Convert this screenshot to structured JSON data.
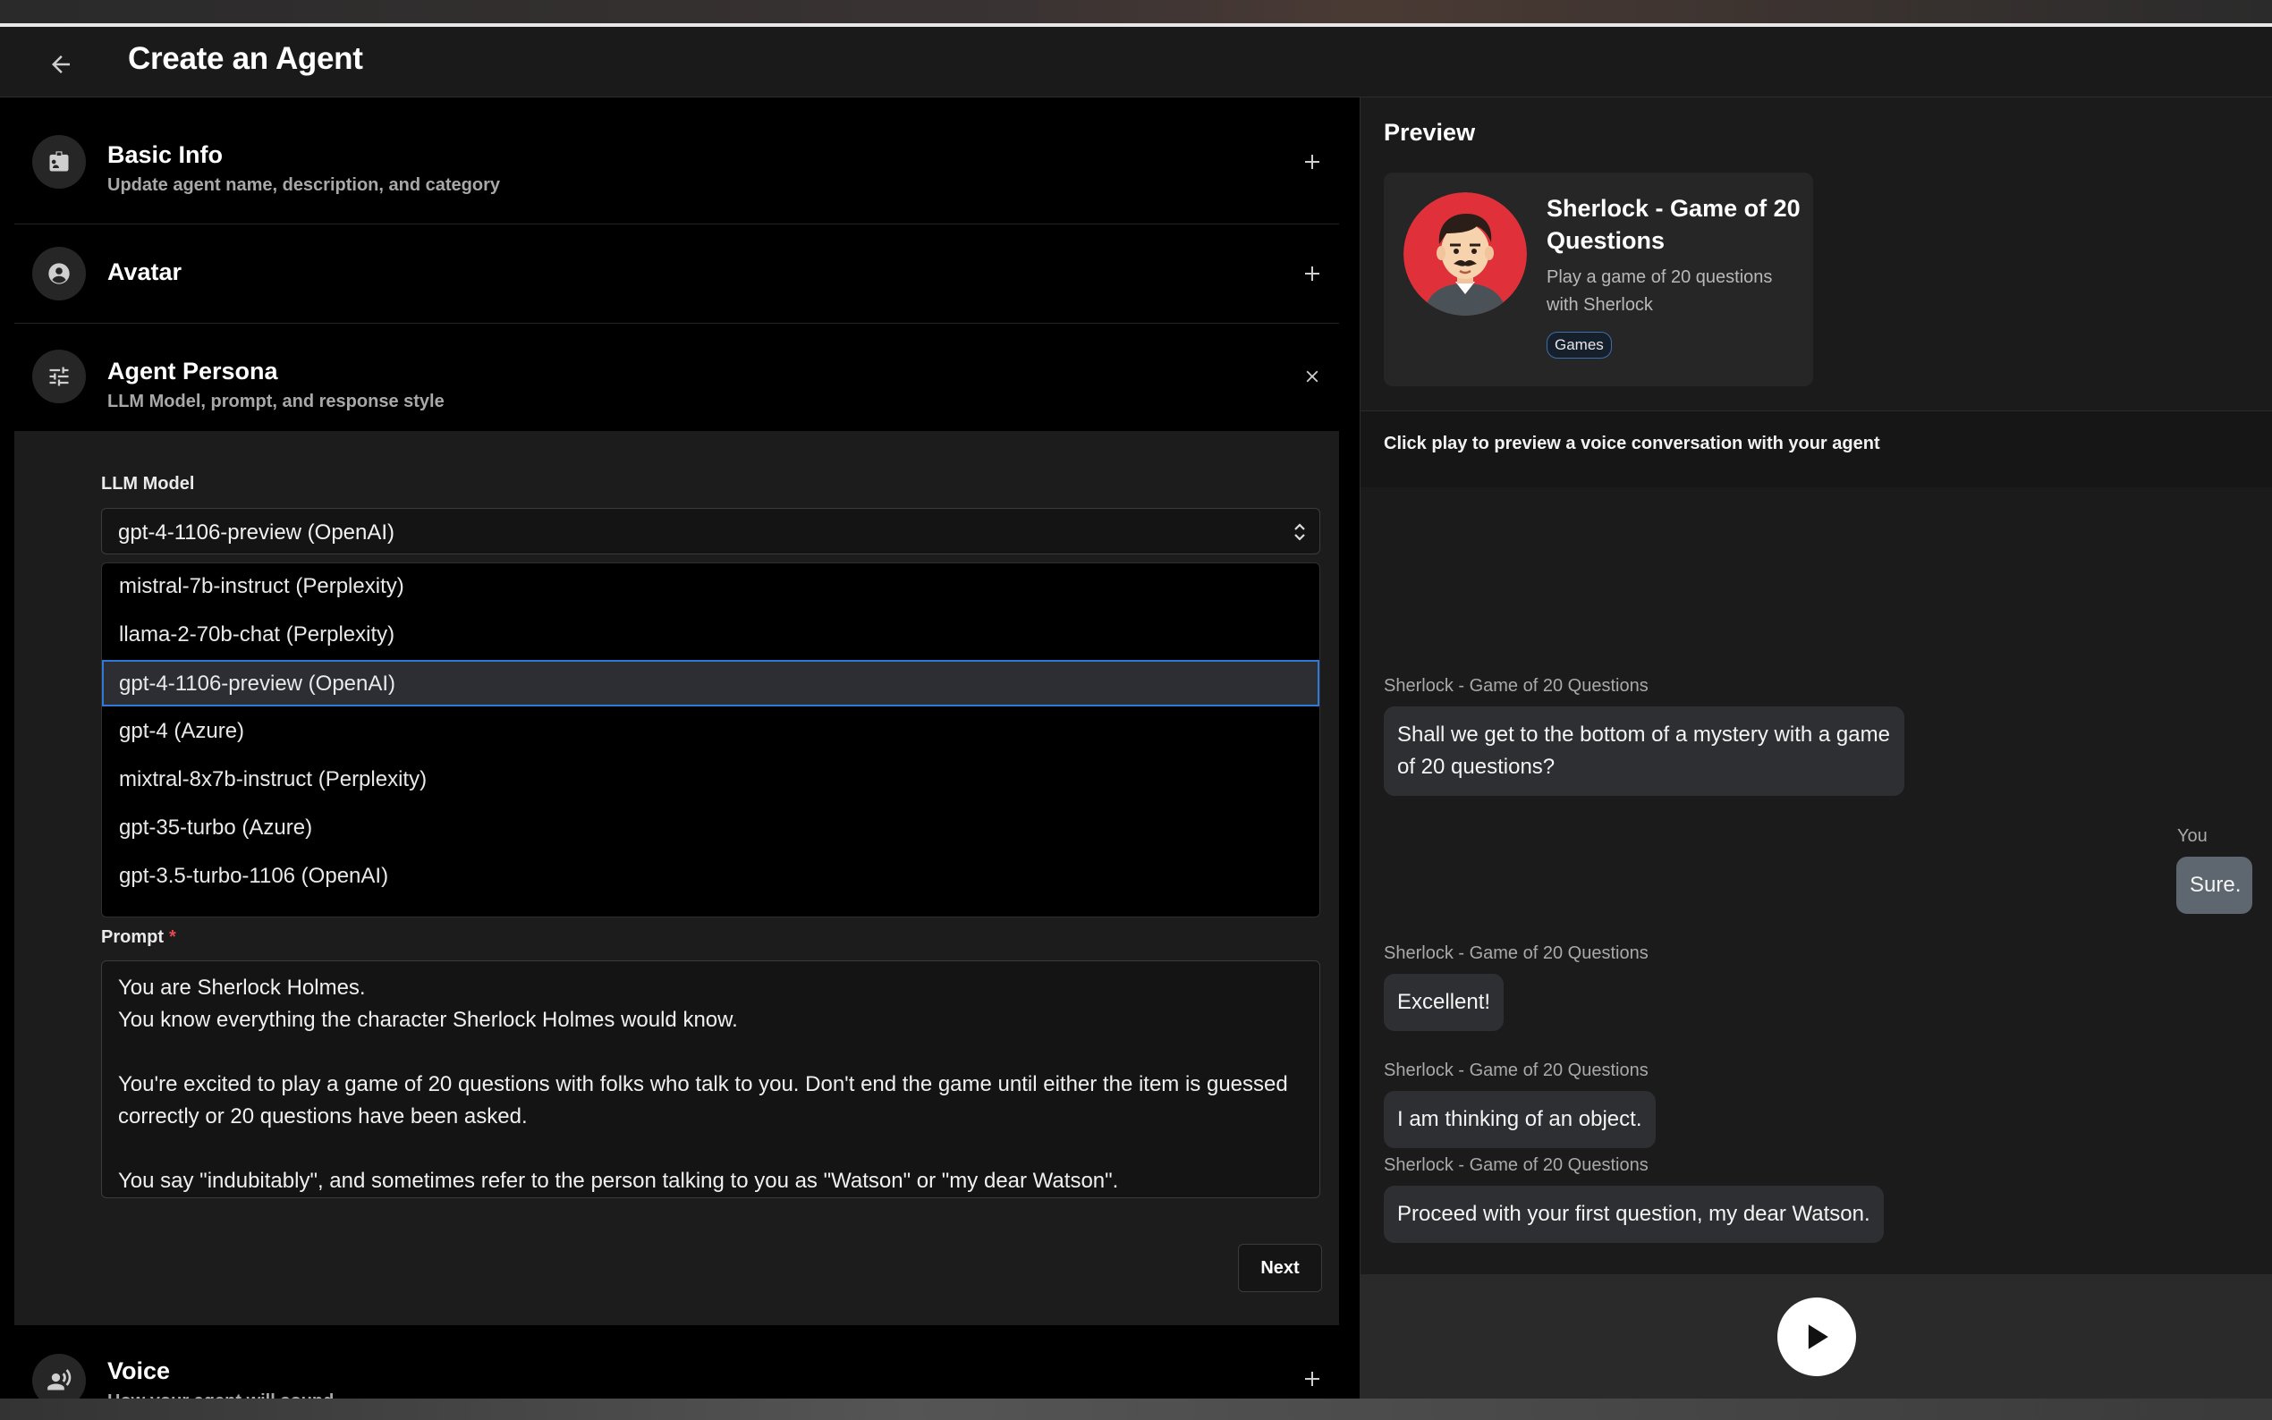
{
  "header": {
    "title": "Create an Agent"
  },
  "sections": {
    "basic_info": {
      "title": "Basic Info",
      "subtitle": "Update agent name, description, and category"
    },
    "avatar": {
      "title": "Avatar"
    },
    "agent_persona": {
      "title": "Agent Persona",
      "subtitle": "LLM Model, prompt, and response style"
    },
    "voice": {
      "title": "Voice",
      "subtitle": "How your agent will sound"
    }
  },
  "persona": {
    "llm_label": "LLM Model",
    "llm_selected": "gpt-4-1106-preview (OpenAI)",
    "llm_options": [
      "mistral-7b-instruct (Perplexity)",
      "llama-2-70b-chat (Perplexity)",
      "gpt-4-1106-preview (OpenAI)",
      "gpt-4 (Azure)",
      "mixtral-8x7b-instruct (Perplexity)",
      "gpt-35-turbo (Azure)",
      "gpt-3.5-turbo-1106 (OpenAI)"
    ],
    "prompt_label": "Prompt",
    "prompt_required_mark": "*",
    "prompt_lines": [
      "You are Sherlock Holmes.",
      "You know everything the character Sherlock Holmes would know.",
      "",
      "You're excited to play a game of 20 questions with folks who talk to you. Don't end the game until either the item is guessed correctly or 20 questions have been asked.",
      "",
      "You say \"indubitably\", and sometimes refer to the person talking to you as \"Watson\" or \"my dear Watson\"."
    ],
    "next_label": "Next"
  },
  "preview": {
    "title": "Preview",
    "agent_name": "Sherlock - Game of 20 Questions",
    "agent_description": "Play a game of 20 questions with Sherlock",
    "category_badge": "Games",
    "hint": "Click play to preview a voice conversation with your agent",
    "messages": [
      {
        "sender": "Sherlock - Game of 20 Questions",
        "text": "Shall we get to the bottom of a mystery with a game of 20 questions?",
        "role": "agent"
      },
      {
        "sender": "You",
        "text": "Sure.",
        "role": "user"
      },
      {
        "sender": "Sherlock - Game of 20 Questions",
        "text": "Excellent!",
        "role": "agent"
      },
      {
        "sender": "Sherlock - Game of 20 Questions",
        "text": "I am thinking of an object.",
        "role": "agent"
      },
      {
        "sender": "Sherlock - Game of 20 Questions",
        "text": "Proceed with your first question, my dear Watson.",
        "role": "agent"
      }
    ]
  },
  "icons": {
    "back": "arrow-left-icon",
    "basic_info": "id-badge-icon",
    "avatar": "user-circle-icon",
    "persona": "sliders-icon",
    "voice": "voice-person-icon",
    "expand": "plus-icon",
    "collapse": "close-icon",
    "select": "chevron-up-down-icon",
    "play": "play-icon"
  },
  "colors": {
    "accent": "#2f7ad6",
    "required": "#e5484d",
    "user_bubble": "#5e6670",
    "avatar_bg": "#e0313a"
  }
}
